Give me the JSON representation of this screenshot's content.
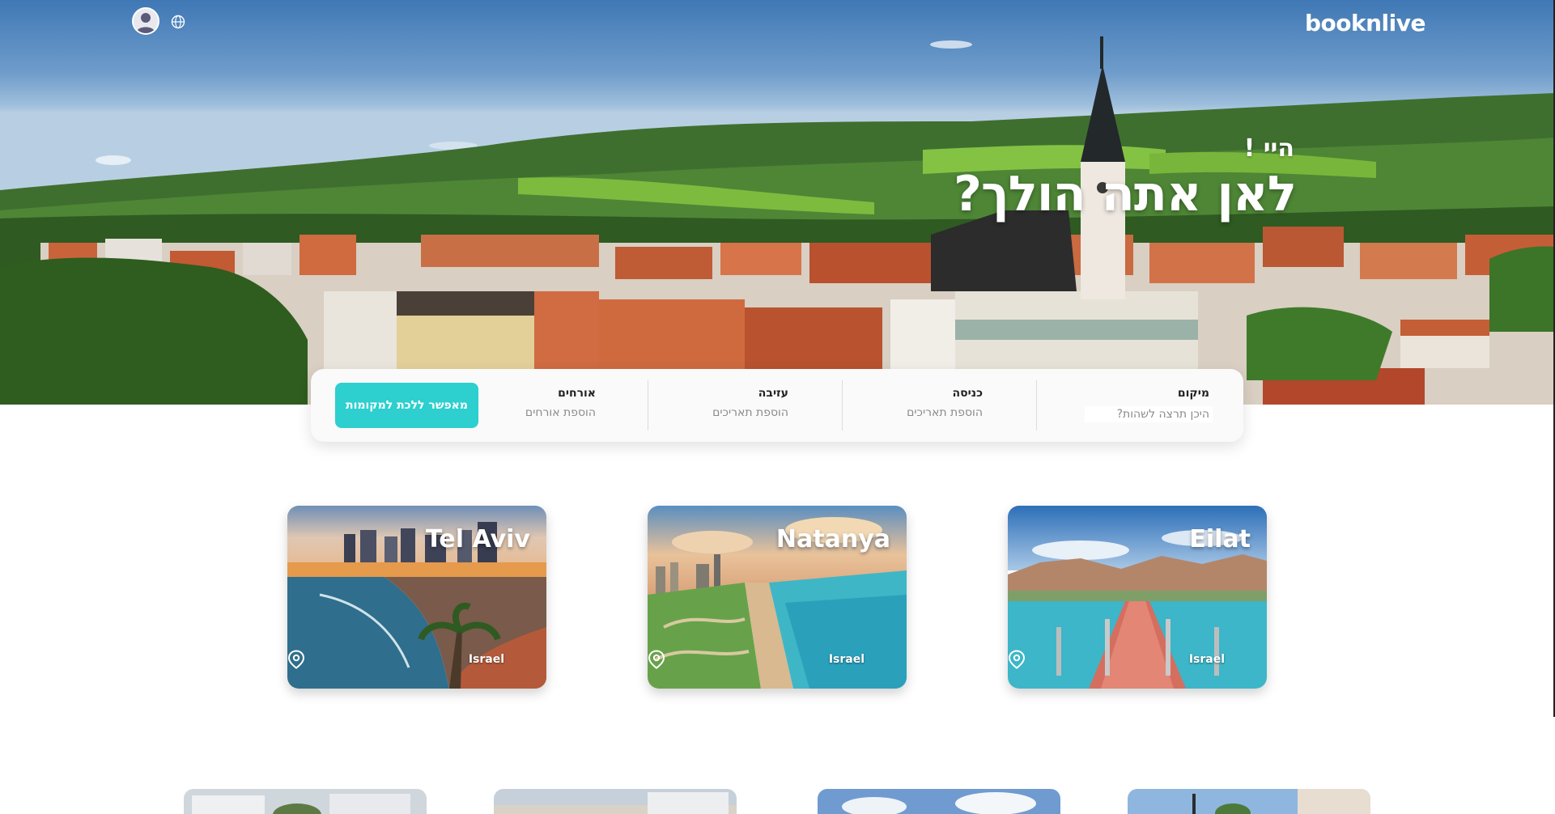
{
  "brand": {
    "logo": "booknlive"
  },
  "hero": {
    "greeting": "היי !",
    "headline": "לאן אתה הולך?"
  },
  "search": {
    "location": {
      "label": "מיקום",
      "placeholder": "היכן תרצה לשהות?"
    },
    "checkin": {
      "label": "כניסה",
      "value": "הוספת תאריכים"
    },
    "checkout": {
      "label": "עזיבה",
      "value": "הוספת תאריכים"
    },
    "guests": {
      "label": "אורחים",
      "value": "הוספת אורחים"
    },
    "button_label": "מאפשר ללכת למקומות"
  },
  "destinations": [
    {
      "city": "Tel Aviv",
      "country": "Israel"
    },
    {
      "city": "Natanya",
      "country": "Israel"
    },
    {
      "city": "Eilat",
      "country": "Israel"
    }
  ],
  "colors": {
    "accent": "#2dcfcf",
    "text": "#222222",
    "muted": "#8a8a8a"
  },
  "icons": {
    "user": "user-avatar-icon",
    "language": "globe-icon",
    "location": "map-pin-icon"
  }
}
